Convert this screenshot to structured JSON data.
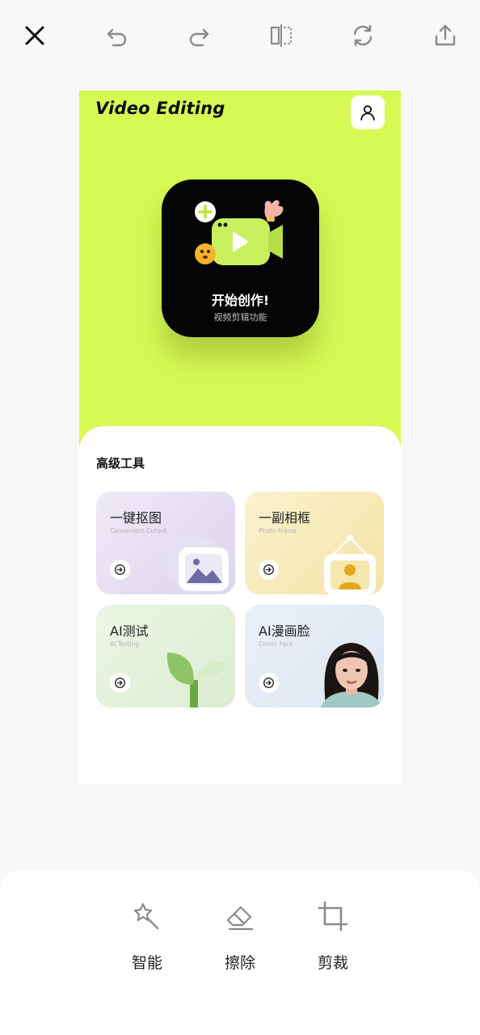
{
  "toolbar": {
    "icons": [
      "close-icon",
      "undo-icon",
      "redo-icon",
      "flip-icon",
      "rotate-icon",
      "share-icon"
    ]
  },
  "canvas": {
    "brand": "Video Editing",
    "accent_color": "#d6f954",
    "create_card": {
      "title": "开始创作!",
      "subtitle": "视频剪辑功能"
    },
    "tools_section": {
      "title": "高级工具",
      "tools": [
        {
          "name": "一键抠图",
          "subtitle": "Convenient Cutout"
        },
        {
          "name": "一副相框",
          "subtitle": "Photo Frame"
        },
        {
          "name": "AI测试",
          "subtitle": "AI Testing"
        },
        {
          "name": "AI漫画脸",
          "subtitle": "Comic Face"
        }
      ]
    }
  },
  "bottom_panel": {
    "items": [
      {
        "label": "智能",
        "icon": "magic-wand-icon"
      },
      {
        "label": "擦除",
        "icon": "eraser-icon"
      },
      {
        "label": "剪裁",
        "icon": "crop-icon"
      }
    ]
  }
}
